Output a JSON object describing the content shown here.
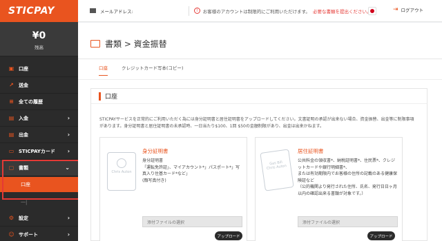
{
  "brand": {
    "logo": "STICPAY",
    "accent": "#e9541f"
  },
  "balance": {
    "amount": "¥0",
    "label": "残高"
  },
  "sidebar": {
    "items": [
      {
        "label": "口座",
        "icon": "person-card-icon"
      },
      {
        "label": "送金",
        "icon": "chart-icon"
      },
      {
        "label": "全ての履歴",
        "icon": "list-icon"
      },
      {
        "label": "入金",
        "icon": "deposit-icon",
        "chevron": "›"
      },
      {
        "label": "出金",
        "icon": "withdraw-icon",
        "chevron": "›"
      },
      {
        "label": "STICPAYカード",
        "icon": "card-icon",
        "chevron": "›"
      },
      {
        "label": "書類",
        "icon": "folder-icon",
        "chevron": "⌄"
      },
      {
        "label": "設定",
        "icon": "gear-icon",
        "chevron": "›"
      },
      {
        "label": "サポート",
        "icon": "support-icon",
        "chevron": "›"
      }
    ],
    "sub_active": "口座",
    "sub_other": "一|"
  },
  "header": {
    "mail_label": "メールアドレス:",
    "warning_text": "お客様のアカウントは制限的にご利用いただけます。",
    "warning_link": "必要な書類を提出ください。",
    "logout": "ログアウト"
  },
  "main": {
    "breadcrumb": "書類 > 資金振替",
    "tabs": [
      "口座",
      "クレジットカード写本(コピー)"
    ],
    "panel_title": "口座",
    "panel_desc": "STICPAYサービスを正常的にご利用いただく為には身分証明書と居住証明書をアップロードしてください。文書証明の承認が出来ない場合、資金振替、出金等に制限事項があります。身分証明書と居住証明書の未承認時、一日当たり$100、1回 $50の金額制限があり、出金は出来かねます。",
    "cards": [
      {
        "title": "身分証明書",
        "body": "身分証明書\n「運転免許証」、マイアカウント*」パスポート*」写真入り住基カード*など」\n(顔写真付き)",
        "doc_text": "Chris Auton",
        "file_placeholder": "添付ファイルの選択",
        "button": "アップロード"
      },
      {
        "title": "居住証明書",
        "body": "公共料金の領収書*、納税証明書*、住民票*、クレジットカードや銀行明細書*、\nまたは有効期限内でお客様の住所の記載のある健康保険証など\n（公的機関より発行された住所、氏名、発行日日ヶ月以内の確認出来る書類が対象です。）",
        "doc_text": "Gas Bill\nChris Auton",
        "file_placeholder": "添付ファイルの選択",
        "button": "アップロード"
      }
    ]
  }
}
